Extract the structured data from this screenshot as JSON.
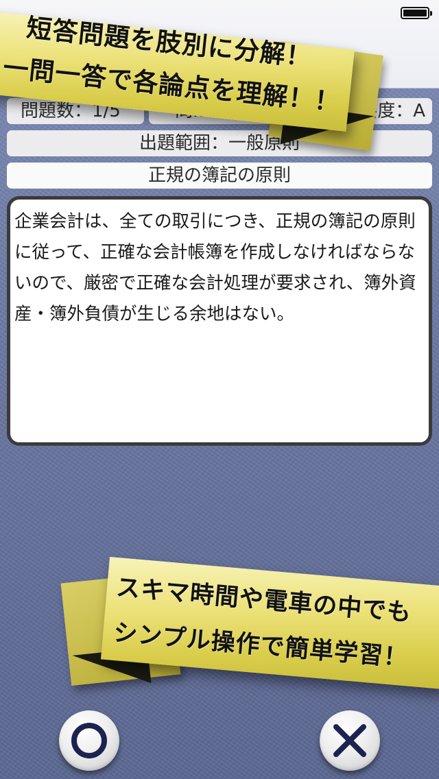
{
  "header": {
    "question_count": "問題数：1/5",
    "question_id": "問ID：1-2-1",
    "importance": "重要度：A"
  },
  "question": {
    "scope": "出題範囲：一般原則",
    "topic": "正規の簿記の原則",
    "text": "企業会計は、全ての取引につき、正規の簿記の原則に従って、正確な会計帳簿を作成しなければならないので、厳密で正確な会計処理が要求され、簿外資産・簿外負債が生じる余地はない。"
  },
  "banners": {
    "top": {
      "line1": "短答問題を肢別に分解！",
      "line2": "一問一答で各論点を理解！！"
    },
    "bottom": {
      "line1": "スキマ時間や電車の中でも",
      "line2": "シンプル操作で簡単学習！"
    }
  },
  "answers": {
    "correct_icon": "circle-icon",
    "wrong_icon": "cross-icon"
  },
  "colors": {
    "banner_yellow": "#ece27a",
    "background_blue": "#6c79a4",
    "icon_navy": "#1c2350"
  }
}
